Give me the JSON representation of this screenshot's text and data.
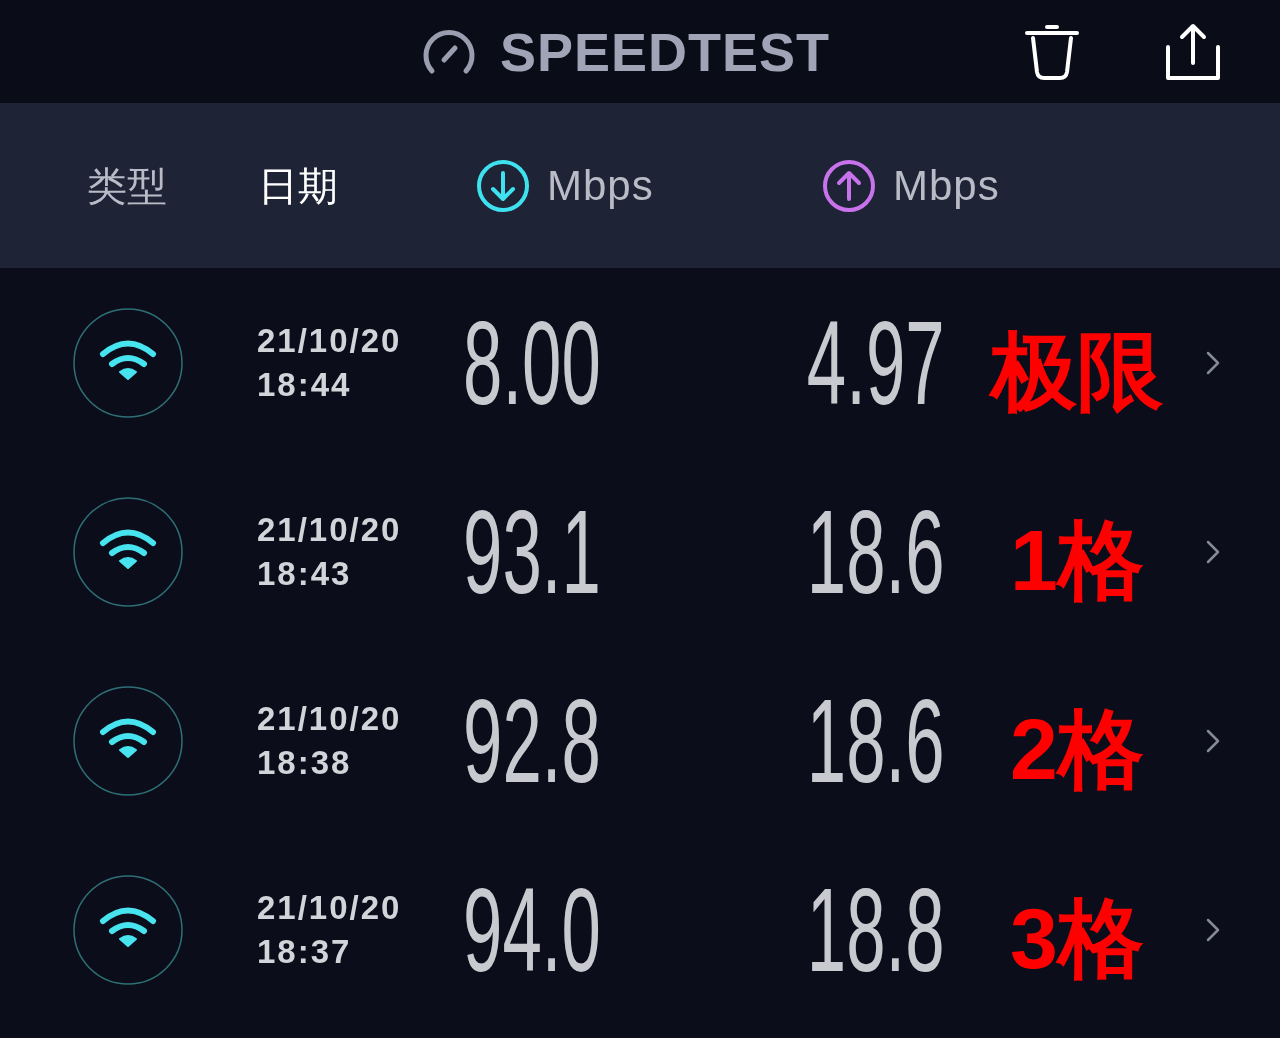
{
  "header": {
    "title": "SPEEDTEST"
  },
  "columns": [
    {
      "kind": "text",
      "label": "类型",
      "selected": false
    },
    {
      "kind": "text",
      "label": "日期",
      "selected": true
    },
    {
      "kind": "download",
      "label": "Mbps",
      "selected": false
    },
    {
      "kind": "upload",
      "label": "Mbps",
      "selected": false
    }
  ],
  "rows": [
    {
      "kind": "wifi",
      "date": "21/10/20",
      "time": "18:44",
      "download": "8.00",
      "upload": "4.97",
      "note": "极限"
    },
    {
      "kind": "wifi",
      "date": "21/10/20",
      "time": "18:43",
      "download": "93.1",
      "upload": "18.6",
      "note": "1格"
    },
    {
      "kind": "wifi",
      "date": "21/10/20",
      "time": "18:38",
      "download": "92.8",
      "upload": "18.6",
      "note": "2格"
    },
    {
      "kind": "wifi",
      "date": "21/10/20",
      "time": "18:37",
      "download": "94.0",
      "upload": "18.8",
      "note": "3格"
    }
  ]
}
